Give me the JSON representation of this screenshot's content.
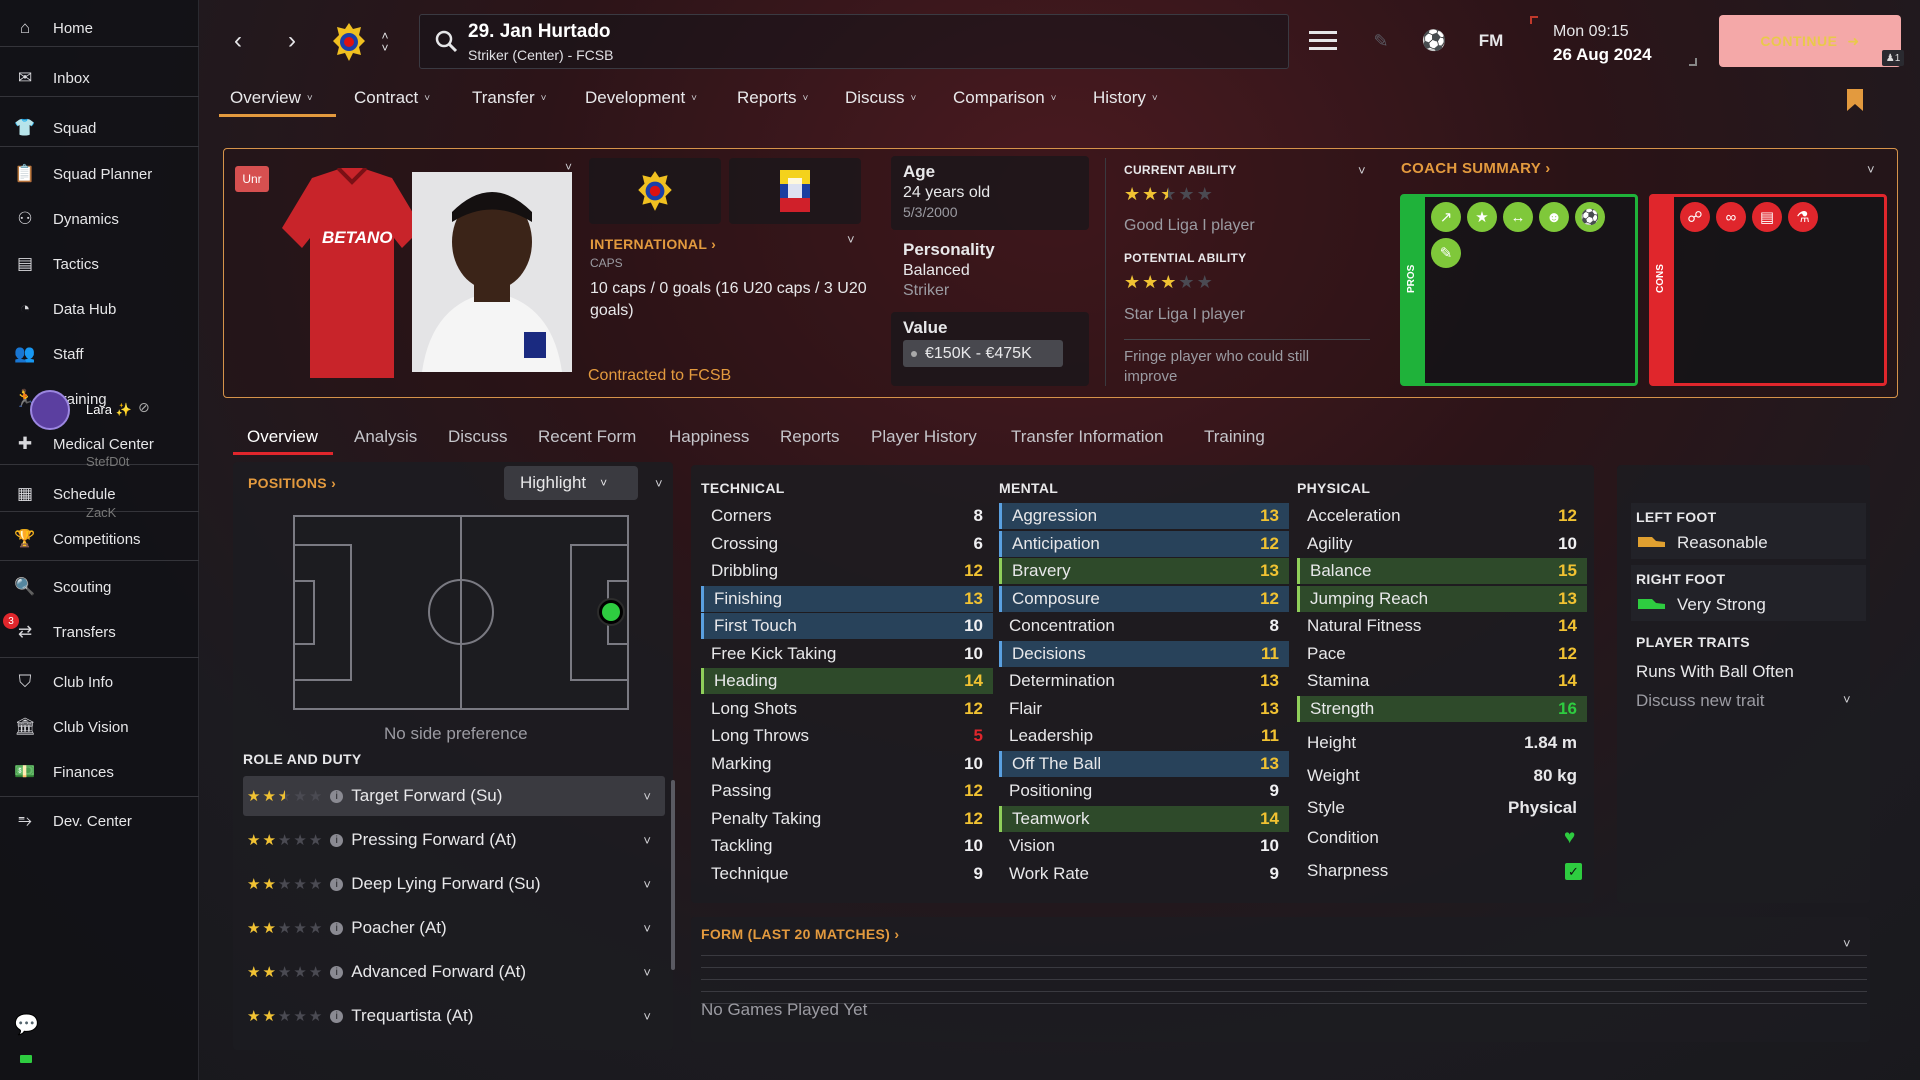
{
  "sidebar": {
    "items": [
      {
        "label": "Home",
        "icon": "home-icon"
      },
      {
        "label": "Inbox",
        "icon": "inbox-icon"
      },
      {
        "label": "Squad",
        "icon": "squad-icon"
      },
      {
        "label": "Squad Planner",
        "icon": "clipboard-icon"
      },
      {
        "label": "Dynamics",
        "icon": "dynamics-icon"
      },
      {
        "label": "Tactics",
        "icon": "tactics-icon"
      },
      {
        "label": "Data Hub",
        "icon": "data-hub-icon"
      },
      {
        "label": "Staff",
        "icon": "staff-icon"
      },
      {
        "label": "Training",
        "icon": "training-icon"
      },
      {
        "label": "Medical Center",
        "icon": "medical-icon"
      },
      {
        "label": "Schedule",
        "icon": "calendar-icon"
      },
      {
        "label": "Competitions",
        "icon": "trophy-icon"
      },
      {
        "label": "Scouting",
        "icon": "scouting-icon"
      },
      {
        "label": "Transfers",
        "icon": "transfers-icon"
      },
      {
        "label": "Club Info",
        "icon": "shield-icon"
      },
      {
        "label": "Club Vision",
        "icon": "vision-icon"
      },
      {
        "label": "Finances",
        "icon": "finances-icon"
      },
      {
        "label": "Dev. Center",
        "icon": "dev-center-icon"
      }
    ],
    "transfers_badge": "3",
    "overlay_users": [
      {
        "name": "Lara ✨"
      },
      {
        "name": "StefD0t"
      },
      {
        "name": "ZacK"
      }
    ]
  },
  "topbar": {
    "player_title": "29. Jan Hurtado",
    "player_subtitle": "Striker (Center) - FCSB",
    "logo_text": "FM",
    "day_time": "Mon 09:15",
    "date": "26 Aug 2024",
    "continue_label": "CONTINUE",
    "continue_badge": "1"
  },
  "menu": [
    "Overview",
    "Contract",
    "Transfer",
    "Development",
    "Reports",
    "Discuss",
    "Comparison",
    "History"
  ],
  "header": {
    "status_badge": "Unr",
    "shirt_sponsor": "BETANO",
    "international_label": "INTERNATIONAL",
    "caps_label": "CAPS",
    "caps_text": "10 caps / 0 goals (16 U20 caps / 3 U20 goals)",
    "contract_text": "Contracted to FCSB",
    "age_label": "Age",
    "age_value": "24 years old",
    "dob": "5/3/2000",
    "personality_label": "Personality",
    "personality_value": "Balanced",
    "personality_role": "Striker",
    "value_label": "Value",
    "value_amount": "€150K - €475K",
    "current_ability_label": "CURRENT ABILITY",
    "current_ability_stars": 2.5,
    "current_ability_text": "Good Liga I player",
    "potential_ability_label": "POTENTIAL ABILITY",
    "potential_ability_stars": 3,
    "potential_ability_text": "Star Liga I player",
    "fringe_text": "Fringe player who could still improve",
    "coach_summary_label": "COACH SUMMARY",
    "pros_label": "PROS",
    "cons_label": "CONS",
    "pros_icons": [
      "trend-up-icon",
      "star-icon",
      "stretch-icon",
      "head-icon",
      "ball-icon",
      "boot-icon"
    ],
    "cons_icons": [
      "injury-icon",
      "feet-icon",
      "notes-icon",
      "flask-icon"
    ]
  },
  "tabs": [
    "Overview",
    "Analysis",
    "Discuss",
    "Recent Form",
    "Happiness",
    "Reports",
    "Player History",
    "Transfer Information",
    "Training"
  ],
  "positions": {
    "title": "POSITIONS",
    "highlight_label": "Highlight",
    "side_pref": "No side preference"
  },
  "roles": {
    "title": "ROLE AND DUTY",
    "items": [
      {
        "name": "Target Forward (Su)",
        "stars": 2.5
      },
      {
        "name": "Pressing Forward (At)",
        "stars": 2
      },
      {
        "name": "Deep Lying Forward (Su)",
        "stars": 2
      },
      {
        "name": "Poacher (At)",
        "stars": 2
      },
      {
        "name": "Advanced Forward (At)",
        "stars": 2
      },
      {
        "name": "Trequartista (At)",
        "stars": 2
      }
    ]
  },
  "technical": {
    "title": "TECHNICAL",
    "attrs": [
      {
        "n": "Corners",
        "v": "8"
      },
      {
        "n": "Crossing",
        "v": "6"
      },
      {
        "n": "Dribbling",
        "v": "12"
      },
      {
        "n": "Finishing",
        "v": "13",
        "hl": "blue"
      },
      {
        "n": "First Touch",
        "v": "10",
        "hl": "blue"
      },
      {
        "n": "Free Kick Taking",
        "v": "10"
      },
      {
        "n": "Heading",
        "v": "14",
        "hl": "green"
      },
      {
        "n": "Long Shots",
        "v": "12"
      },
      {
        "n": "Long Throws",
        "v": "5"
      },
      {
        "n": "Marking",
        "v": "10"
      },
      {
        "n": "Passing",
        "v": "12"
      },
      {
        "n": "Penalty Taking",
        "v": "12"
      },
      {
        "n": "Tackling",
        "v": "10"
      },
      {
        "n": "Technique",
        "v": "9"
      }
    ]
  },
  "mental": {
    "title": "MENTAL",
    "attrs": [
      {
        "n": "Aggression",
        "v": "13",
        "hl": "blue"
      },
      {
        "n": "Anticipation",
        "v": "12",
        "hl": "blue"
      },
      {
        "n": "Bravery",
        "v": "13",
        "hl": "green"
      },
      {
        "n": "Composure",
        "v": "12",
        "hl": "blue"
      },
      {
        "n": "Concentration",
        "v": "8"
      },
      {
        "n": "Decisions",
        "v": "11",
        "hl": "blue"
      },
      {
        "n": "Determination",
        "v": "13"
      },
      {
        "n": "Flair",
        "v": "13"
      },
      {
        "n": "Leadership",
        "v": "11"
      },
      {
        "n": "Off The Ball",
        "v": "13",
        "hl": "blue"
      },
      {
        "n": "Positioning",
        "v": "9"
      },
      {
        "n": "Teamwork",
        "v": "14",
        "hl": "green"
      },
      {
        "n": "Vision",
        "v": "10"
      },
      {
        "n": "Work Rate",
        "v": "9"
      }
    ]
  },
  "physical": {
    "title": "PHYSICAL",
    "attrs": [
      {
        "n": "Acceleration",
        "v": "12"
      },
      {
        "n": "Agility",
        "v": "10"
      },
      {
        "n": "Balance",
        "v": "15",
        "hl": "green"
      },
      {
        "n": "Jumping Reach",
        "v": "13",
        "hl": "green"
      },
      {
        "n": "Natural Fitness",
        "v": "14"
      },
      {
        "n": "Pace",
        "v": "12"
      },
      {
        "n": "Stamina",
        "v": "14"
      },
      {
        "n": "Strength",
        "v": "16",
        "hl": "green"
      }
    ],
    "info": [
      {
        "n": "Height",
        "v": "1.84 m"
      },
      {
        "n": "Weight",
        "v": "80 kg"
      },
      {
        "n": "Style",
        "v": "Physical"
      }
    ],
    "condition_label": "Condition",
    "sharpness_label": "Sharpness"
  },
  "feet": {
    "left_label": "LEFT FOOT",
    "left_value": "Reasonable",
    "right_label": "RIGHT FOOT",
    "right_value": "Very Strong",
    "traits_label": "PLAYER TRAITS",
    "trait": "Runs With Ball Often",
    "discuss_trait": "Discuss new trait"
  },
  "form": {
    "title": "FORM (LAST 20 MATCHES)",
    "empty": "No Games Played Yet"
  },
  "colors": {
    "accent": "#e39a3e",
    "green": "#2ecc40",
    "red": "#e0262c",
    "highlight_blue": "#28425a",
    "highlight_green": "#2e4a2a"
  }
}
